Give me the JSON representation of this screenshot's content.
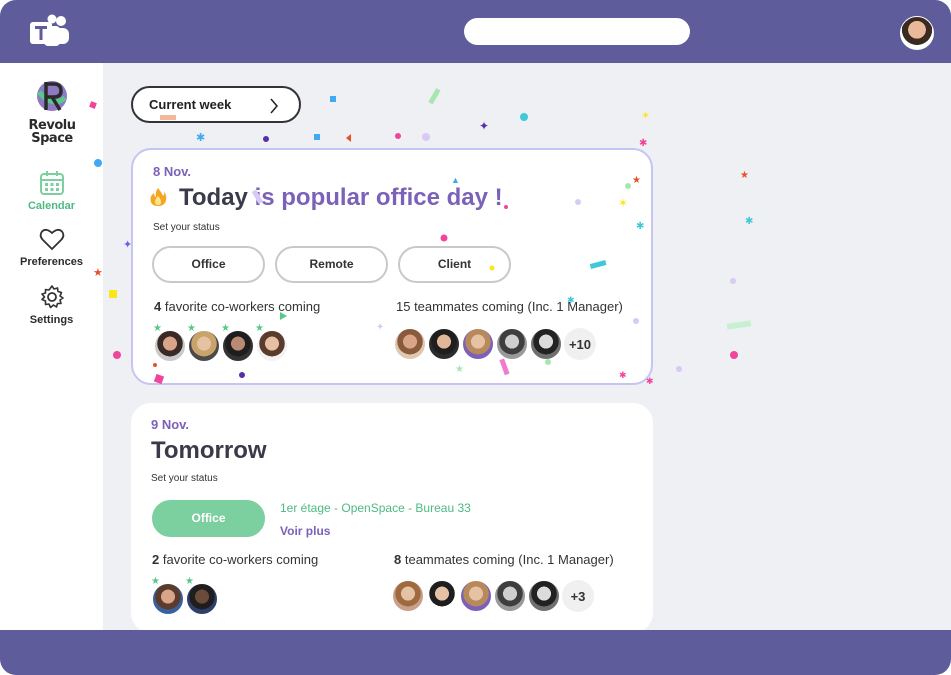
{
  "app": {
    "name": "Microsoft Teams"
  },
  "brand": {
    "name_line1": "Revolu",
    "name_line2": "Space"
  },
  "sidebar": {
    "items": [
      {
        "label": "Calendar",
        "icon": "calendar-icon",
        "active": true
      },
      {
        "label": "Preferences",
        "icon": "heart-icon",
        "active": false
      },
      {
        "label": "Settings",
        "icon": "gear-icon",
        "active": false
      }
    ]
  },
  "week_selector": {
    "label": "Current week"
  },
  "today": {
    "date": "8 Nov.",
    "headline_strong": "Today",
    "headline_accent": " is popular office day !",
    "set_status": "Set your status",
    "status_options": [
      "Office",
      "Remote",
      "Client"
    ],
    "favorites_count": "4",
    "favorites_text": " favorite co-workers coming",
    "teammates_text": "15 teammates coming (Inc. 1 Manager)",
    "teammates_more": "+10"
  },
  "tomorrow": {
    "date": "9 Nov.",
    "headline": "Tomorrow",
    "set_status": "Set your status",
    "status_selected": "Office",
    "location": "1er étage - OpenSpace - Bureau 33",
    "voir_plus": "Voir plus",
    "favorites_count": "2",
    "favorites_text": " favorite co-workers coming",
    "teammates_count": "8",
    "teammates_text": " teammates coming (Inc. 1 Manager)",
    "teammates_more": "+3"
  },
  "colors": {
    "teams_bar": "#5e5c9a",
    "accent_purple": "#7b61b8",
    "accent_green": "#4fb983",
    "selected_green": "#7ccf9e",
    "card_border": "#c7c4f2"
  }
}
